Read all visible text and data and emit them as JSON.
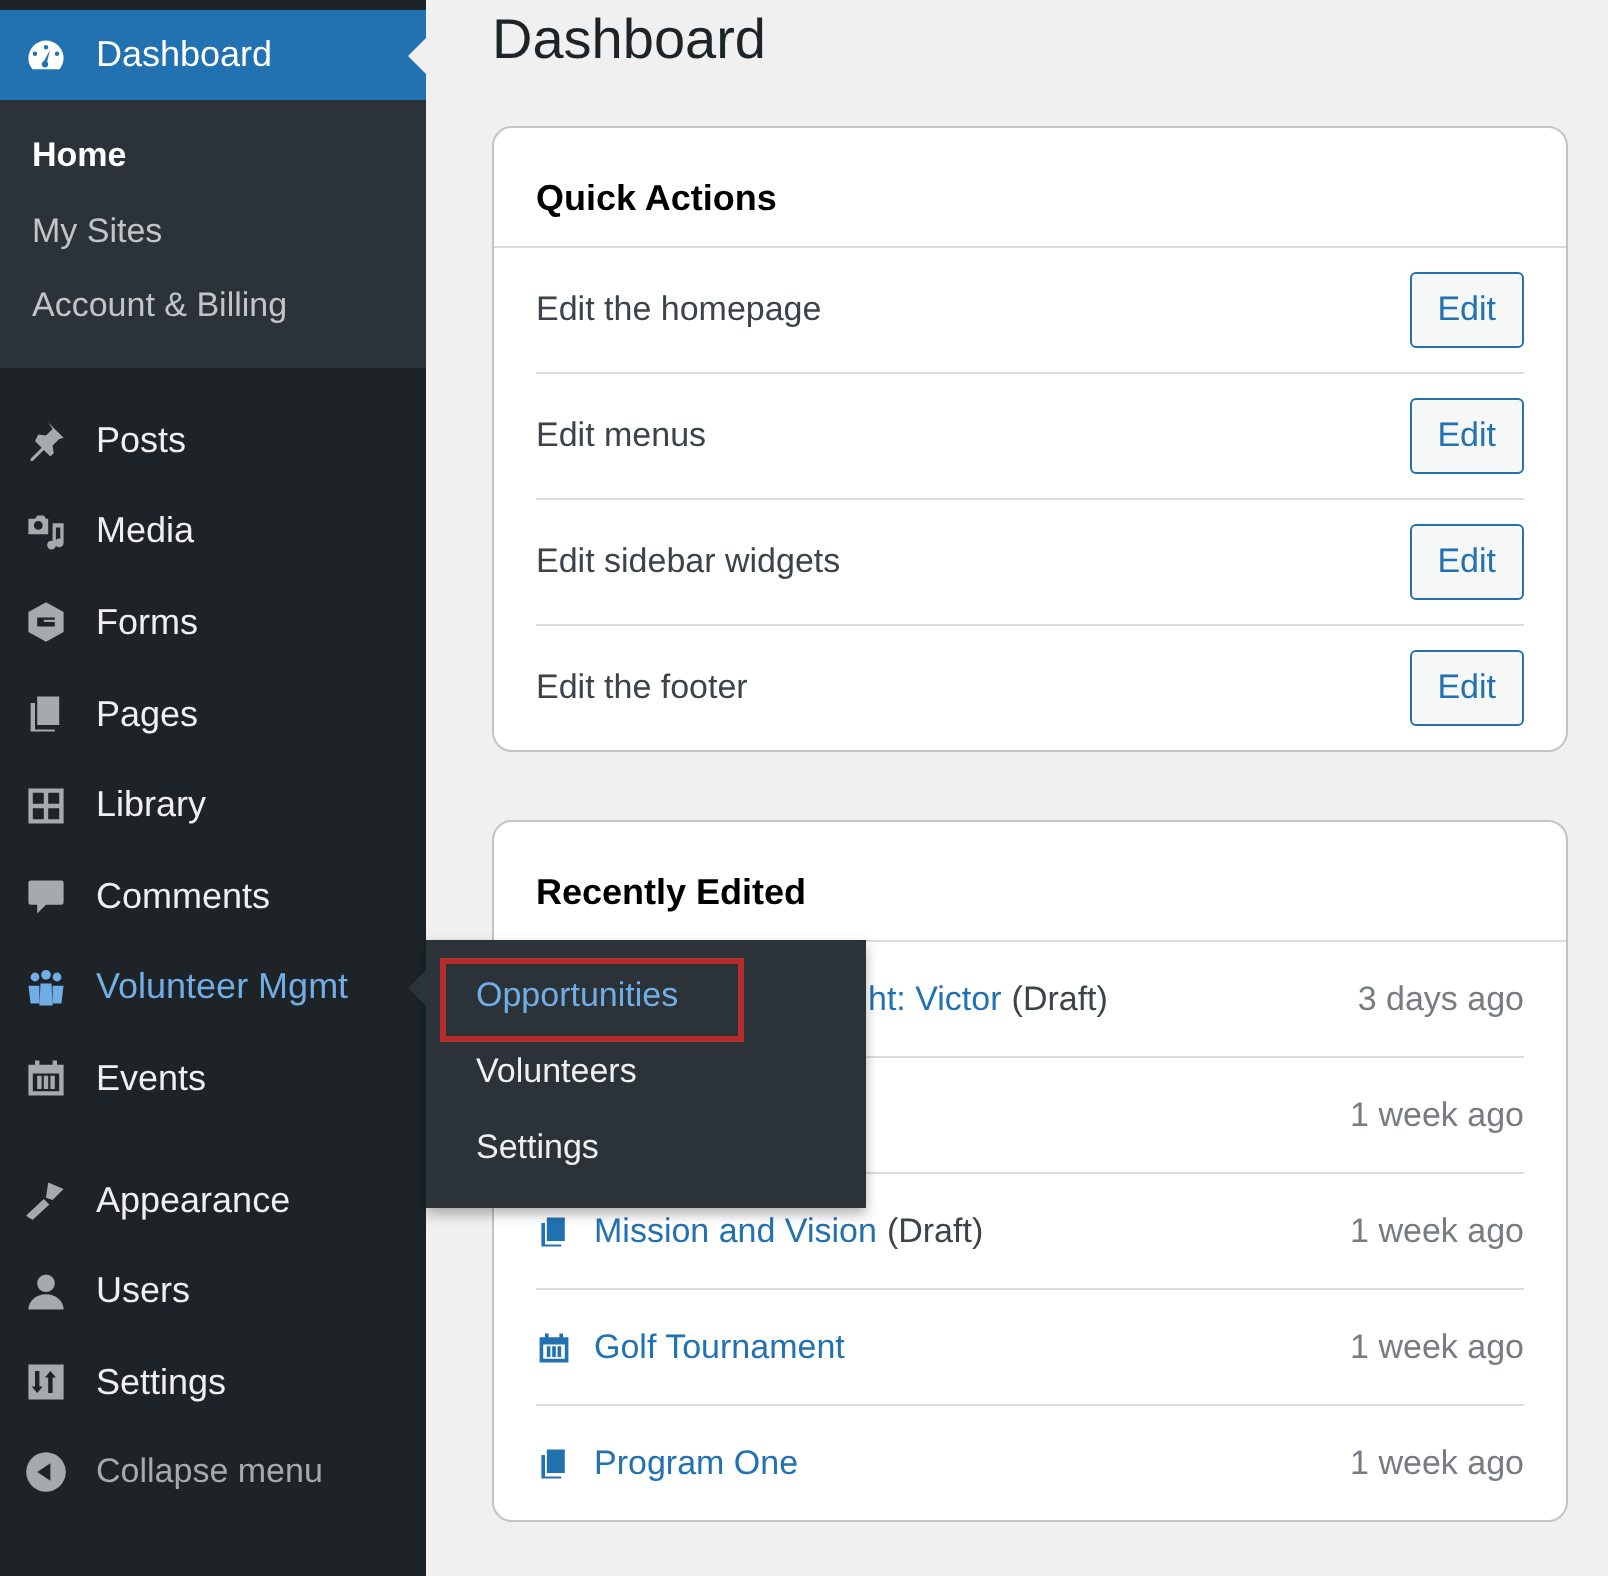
{
  "sidebar": {
    "active": {
      "label": "Dashboard",
      "selected": true
    },
    "submenu": [
      {
        "label": "Home",
        "selected": true
      },
      {
        "label": "My Sites",
        "selected": false
      },
      {
        "label": "Account & Billing",
        "selected": false
      }
    ],
    "groups": [
      [
        {
          "label": "Posts",
          "open": false
        },
        {
          "label": "Media",
          "open": false
        },
        {
          "label": "Forms",
          "open": false
        },
        {
          "label": "Pages",
          "open": false
        },
        {
          "label": "Library",
          "open": false
        },
        {
          "label": "Comments",
          "open": false
        },
        {
          "label": "Volunteer Mgmt",
          "open": true
        },
        {
          "label": "Events",
          "open": false
        }
      ],
      [
        {
          "label": "Appearance",
          "open": false
        },
        {
          "label": "Users",
          "open": false
        },
        {
          "label": "Settings",
          "open": false
        }
      ]
    ],
    "collapse": "Collapse menu"
  },
  "flyout": [
    {
      "label": "Opportunities",
      "selected": true,
      "highlighted": true
    },
    {
      "label": "Volunteers",
      "selected": false,
      "highlighted": false
    },
    {
      "label": "Settings",
      "selected": false,
      "highlighted": false
    }
  ],
  "page_title": "Dashboard",
  "quick_actions": {
    "title": "Quick Actions",
    "rows": [
      {
        "label": "Edit the homepage",
        "button": "Edit"
      },
      {
        "label": "Edit menus",
        "button": "Edit"
      },
      {
        "label": "Edit sidebar widgets",
        "button": "Edit"
      },
      {
        "label": "Edit the footer",
        "button": "Edit"
      }
    ]
  },
  "recently_edited": {
    "title": "Recently Edited",
    "rows": [
      {
        "kind": "covered",
        "title": "ht: Victor",
        "status": "(Draft)",
        "time": "3 days ago"
      },
      {
        "kind": "covered",
        "time": "1 week ago"
      },
      {
        "kind": "page",
        "title": "Mission and Vision",
        "status": "(Draft)",
        "time": "1 week ago"
      },
      {
        "kind": "event",
        "title": "Golf Tournament",
        "time": "1 week ago"
      },
      {
        "kind": "page",
        "title": "Program One",
        "time": "1 week ago"
      }
    ]
  }
}
